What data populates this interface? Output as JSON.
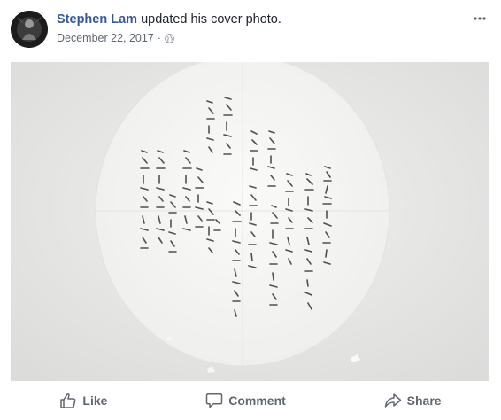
{
  "post": {
    "author": "Stephen Lam",
    "action_text": " updated his cover photo.",
    "date": "December 22, 2017",
    "date_separator": "·",
    "privacy_icon": "globe-icon",
    "more_icon": "more-options-icon"
  },
  "photo": {
    "subject": "cover-photo",
    "circle_color": "#f6f6f5",
    "background_color": "#ececeb",
    "ink_color": "#3a3a3a"
  },
  "actions": {
    "like_label": "Like",
    "comment_label": "Comment",
    "share_label": "Share"
  },
  "colors": {
    "author": "#365899",
    "text": "#1d2129",
    "muted": "#616770",
    "action": "#606770"
  }
}
